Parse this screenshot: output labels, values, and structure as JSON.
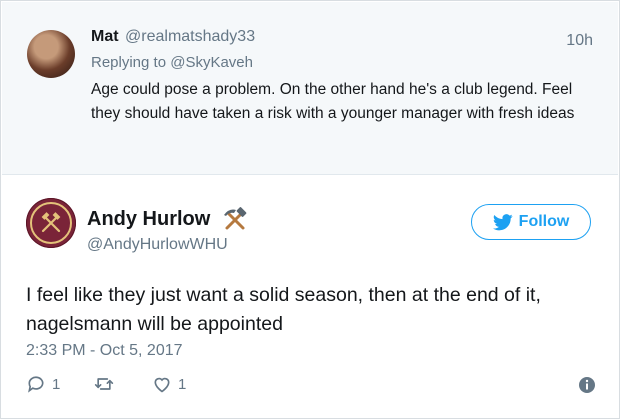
{
  "reply": {
    "name": "Mat",
    "handle": "@realmatshady33",
    "time": "10h",
    "replying_prefix": "Replying to",
    "replying_to": "@SkyKaveh",
    "text": "Age could pose a problem. On the other hand he's a club legend. Feel they should have taken a risk with a younger manager with fresh ideas"
  },
  "tweet": {
    "name": "Andy Hurlow",
    "name_emoji_icon": "hammer-and-pick-icon",
    "handle": "@AndyHurlowWHU",
    "follow_label": "Follow",
    "text": "I feel like they just want a solid season, then at the end of it, nagelsmann will be appointed",
    "timestamp": "2:33 PM - Oct 5, 2017",
    "reply_count": "1",
    "retweet_count": "",
    "like_count": "1"
  },
  "colors": {
    "twitter_blue": "#1da1f2",
    "muted_text": "#657786",
    "reply_background": "#f5f8fa"
  }
}
